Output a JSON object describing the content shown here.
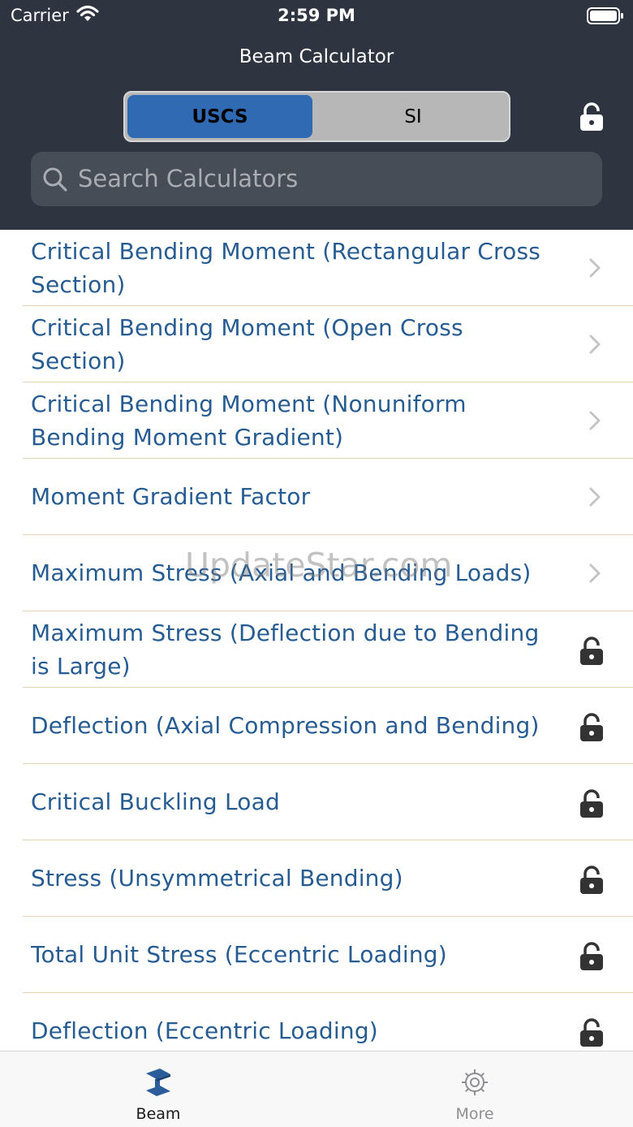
{
  "status_bar": {
    "carrier": "Carrier",
    "time": "2:59 PM"
  },
  "nav": {
    "title": "Beam Calculator"
  },
  "units": {
    "options": [
      "USCS",
      "SI"
    ],
    "selected": "USCS"
  },
  "search": {
    "placeholder": "Search Calculators"
  },
  "calculators": [
    {
      "label": "Critical Bending Moment (Rectangular Cross Section)",
      "locked": false
    },
    {
      "label": "Critical Bending Moment (Open Cross Section)",
      "locked": false
    },
    {
      "label": "Critical Bending Moment (Nonuniform Bending Moment Gradient)",
      "locked": false
    },
    {
      "label": "Moment Gradient Factor",
      "locked": false
    },
    {
      "label": "Maximum Stress (Axial and Bending Loads)",
      "locked": false
    },
    {
      "label": "Maximum Stress (Deflection due to Bending is Large)",
      "locked": true
    },
    {
      "label": "Deflection (Axial Compression and Bending)",
      "locked": true
    },
    {
      "label": "Critical Buckling Load",
      "locked": true
    },
    {
      "label": "Stress (Unsymmetrical Bending)",
      "locked": true
    },
    {
      "label": "Total Unit Stress (Eccentric Loading)",
      "locked": true
    },
    {
      "label": "Deflection (Eccentric Loading)",
      "locked": true
    }
  ],
  "tabbar": {
    "tabs": [
      {
        "label": "Beam",
        "icon": "beam-icon",
        "active": true
      },
      {
        "label": "More",
        "icon": "gear-icon",
        "active": false
      }
    ]
  },
  "watermark": {
    "text": "UpdateStar.com"
  },
  "colors": {
    "header_bg": "#2e3540",
    "segment_selected": "#2f6ab3",
    "row_text": "#275c92",
    "separator": "#e7d4b6",
    "tab_active": "#1a1a1a",
    "tab_inactive": "#8e8e93"
  }
}
